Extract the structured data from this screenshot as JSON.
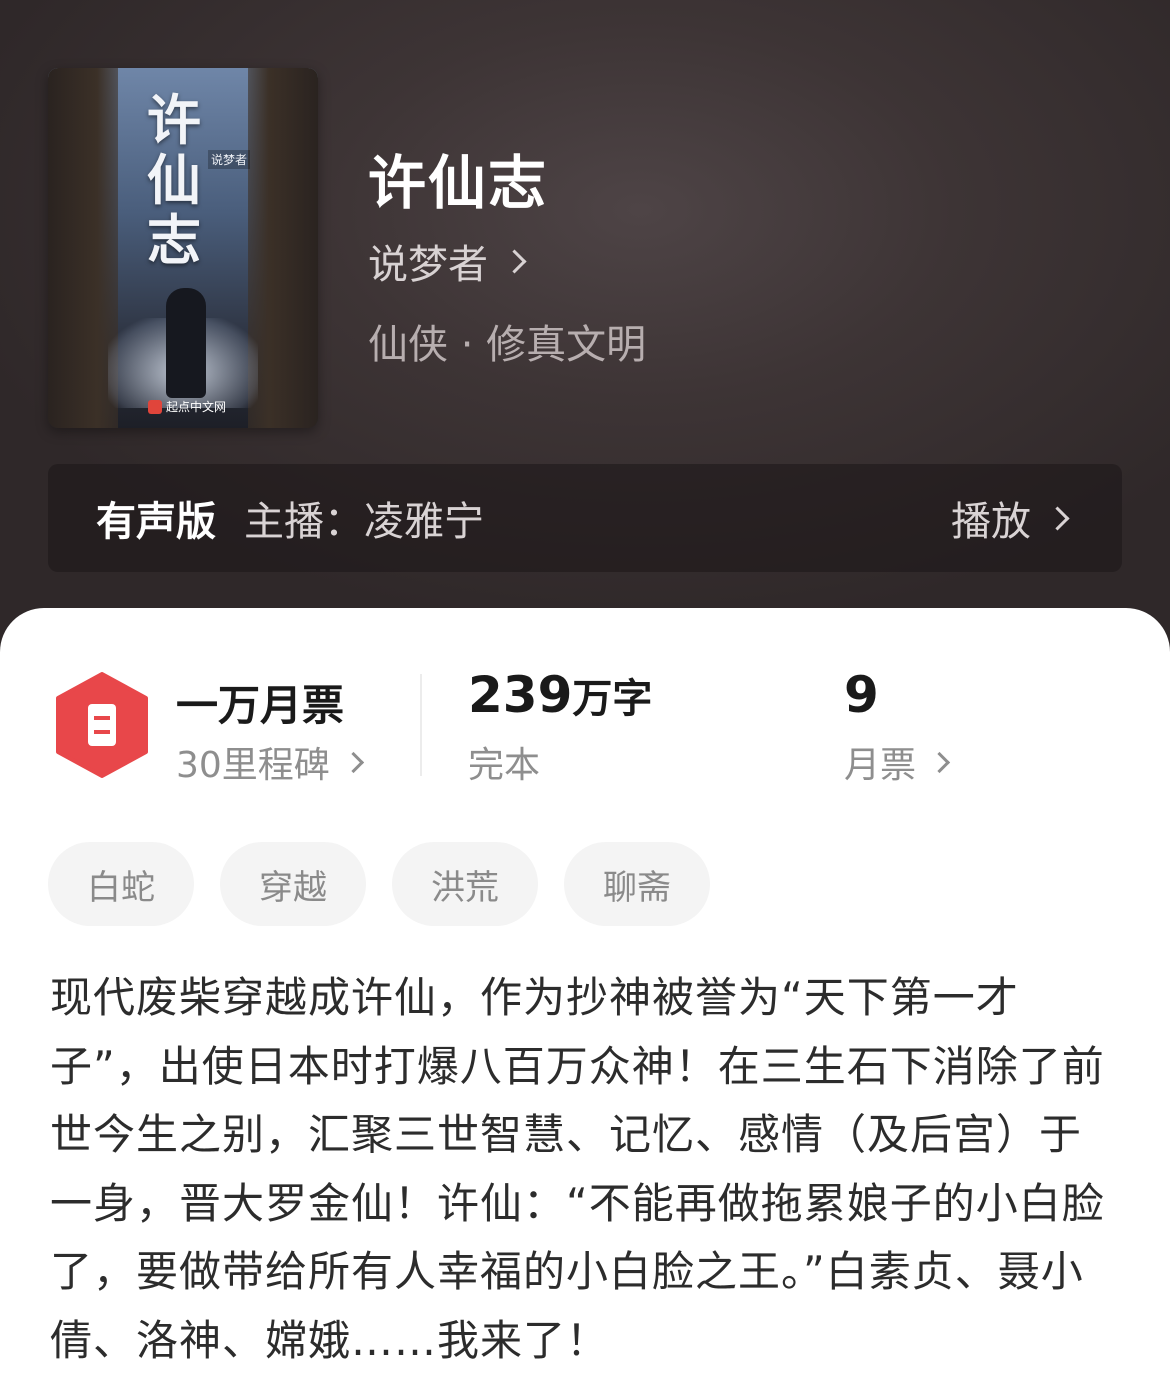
{
  "book": {
    "title": "许仙志",
    "author": "说梦者",
    "genre": "仙侠 · 修真文明",
    "cover": {
      "title_text": "许仙志",
      "author_text": "说梦者",
      "publisher_text": "起点中文网"
    }
  },
  "audio": {
    "label": "有声版",
    "host": "主播：凌雅宁",
    "play_label": "播放"
  },
  "stats": {
    "ticket_title": "一万月票",
    "milestones": "30里程碑",
    "word_count_number": "239",
    "word_count_unit": "万字",
    "status": "完本",
    "monthly_tickets_count": "9",
    "monthly_tickets_label": "月票"
  },
  "tags": [
    "白蛇",
    "穿越",
    "洪荒",
    "聊斋"
  ],
  "synopsis": "现代废柴穿越成许仙，作为抄神被誉为“天下第一才子”，出使日本时打爆八百万众神！在三生石下消除了前世今生之别，汇聚三世智慧、记忆、感情（及后宫）于一身，晋大罗金仙！许仙：“不能再做拖累娘子的小白脸了，要做带给所有人幸福的小白脸之王。”白素贞、聂小倩、洛神、嫦娥……我来了！",
  "colors": {
    "header_bg": "#3d3435",
    "badge_red": "#e8474a",
    "text_dark": "#1a1a1a",
    "text_muted": "#8e8e8e",
    "tag_bg": "#f4f4f4"
  },
  "icons": [
    "chevron-right-icon",
    "ticket-badge-icon"
  ]
}
